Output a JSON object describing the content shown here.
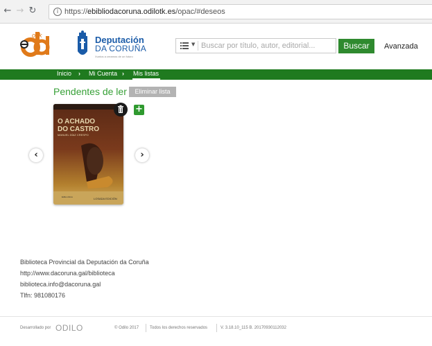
{
  "browser": {
    "url_prefix": "https://",
    "url_host": "ebibliodacoruna.odilotk.es",
    "url_path": "/opac/#deseos",
    "back_icon": "arrow-left-icon",
    "forward_icon": "arrow-right-icon",
    "reload_icon": "reload-icon",
    "info_icon": "info-icon"
  },
  "header": {
    "logo_small_text": "ook",
    "deputacion_title": "Deputación",
    "deputacion_subtitle": "DA CORUÑA",
    "deputacion_tagline": "Xuntos a creamos de un futuro",
    "search": {
      "placeholder": "Buscar por título, autor, editorial...",
      "value": ""
    },
    "search_button": "Buscar",
    "advanced_link": "Avanzada"
  },
  "nav": {
    "breadcrumbs": [
      {
        "label": "Inicio"
      },
      {
        "label": "Mi Cuenta"
      },
      {
        "label": "Mis listas"
      }
    ],
    "separator": "›"
  },
  "main": {
    "list_title": "Pendentes de ler",
    "delete_list_button": "Eliminar lista",
    "prev_arrow": "‹",
    "next_arrow": "›",
    "book": {
      "title_line1": "O ACHADO",
      "title_line2": "DO CASTRO",
      "author": "MANUEL DÍAZ CRESPO",
      "publisher": "LOSADA EDICIÓN",
      "tiny": "Edita Libros"
    },
    "add_button": "+"
  },
  "info": {
    "lines": [
      "Biblioteca Provincial da Deputación da Coruña",
      "http://www.dacoruna.gal/biblioteca",
      "biblioteca.info@dacoruna.gal",
      "Tlfn: 981080176"
    ]
  },
  "footer": {
    "developed_by": "Desarrollado por",
    "odilo": "ODILO",
    "copyright": "© Odilo 2017",
    "rights": "Todos los derechos reservados",
    "version": "V. 3.18.10_115 B. 20170930112032"
  },
  "colors": {
    "nav_green": "#1f7a1f",
    "title_green": "#37a037",
    "button_green": "#2f8a2f",
    "deputacion_blue": "#1a5ba8",
    "eliminar_gray": "#b3b3b3"
  }
}
